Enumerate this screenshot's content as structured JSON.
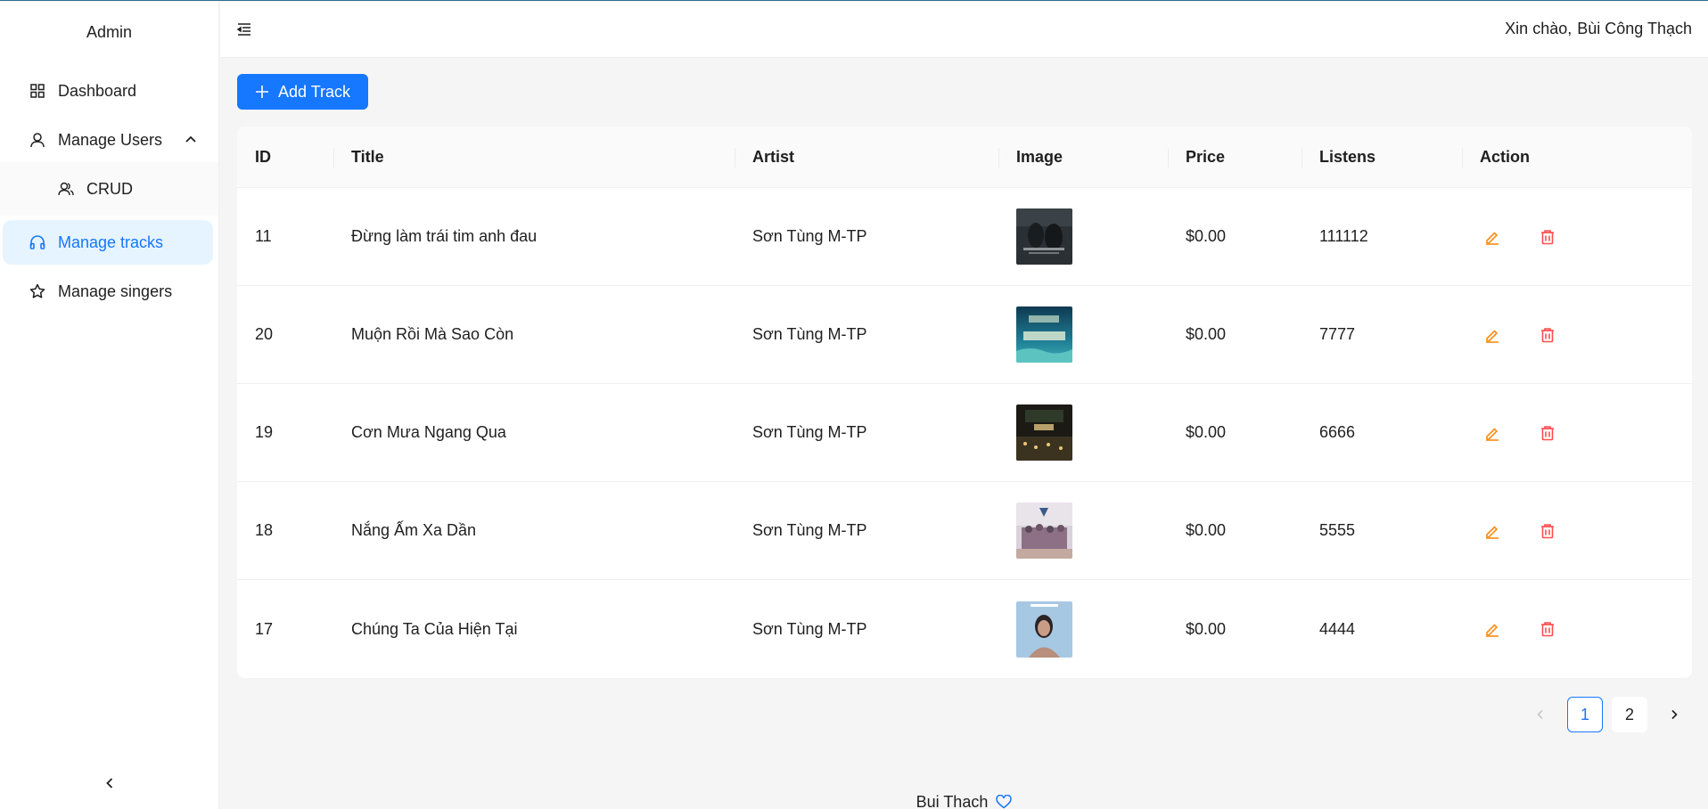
{
  "sidebar": {
    "logo": "Admin",
    "items": [
      {
        "label": "Dashboard",
        "icon": "dashboard-icon"
      },
      {
        "label": "Manage Users",
        "icon": "user-icon",
        "expanded": true
      },
      {
        "label": "CRUD",
        "icon": "team-icon"
      },
      {
        "label": "Manage tracks",
        "icon": "headphones-icon",
        "active": true
      },
      {
        "label": "Manage singers",
        "icon": "star-icon"
      }
    ],
    "collapse_icon": "chevron-left-icon"
  },
  "header": {
    "menu_icon": "menu-fold-icon",
    "greeting": "Xin chào,",
    "user_name": "Bùi Công Thạch"
  },
  "toolbar": {
    "add_label": "Add Track"
  },
  "table": {
    "columns": [
      "ID",
      "Title",
      "Artist",
      "Image",
      "Price",
      "Listens",
      "Action"
    ],
    "rows": [
      {
        "id": "11",
        "title": "Đừng làm trái tim anh đau",
        "artist": "Sơn Tùng M-TP",
        "price": "$0.00",
        "listens": "111112"
      },
      {
        "id": "20",
        "title": "Muộn Rồi Mà Sao Còn",
        "artist": "Sơn Tùng M-TP",
        "price": "$0.00",
        "listens": "7777"
      },
      {
        "id": "19",
        "title": "Cơn Mưa Ngang Qua",
        "artist": "Sơn Tùng M-TP",
        "price": "$0.00",
        "listens": "6666"
      },
      {
        "id": "18",
        "title": "Nắng Ấm Xa Dần",
        "artist": "Sơn Tùng M-TP",
        "price": "$0.00",
        "listens": "5555"
      },
      {
        "id": "17",
        "title": "Chúng Ta Của Hiện Tại",
        "artist": "Sơn Tùng M-TP",
        "price": "$0.00",
        "listens": "4444"
      }
    ]
  },
  "pagination": {
    "pages": [
      "1",
      "2"
    ],
    "current": "1"
  },
  "footer": {
    "text": "Bui Thach"
  },
  "colors": {
    "accent": "#1677ff",
    "edit": "#fa8c16",
    "delete": "#ff4d4f"
  }
}
